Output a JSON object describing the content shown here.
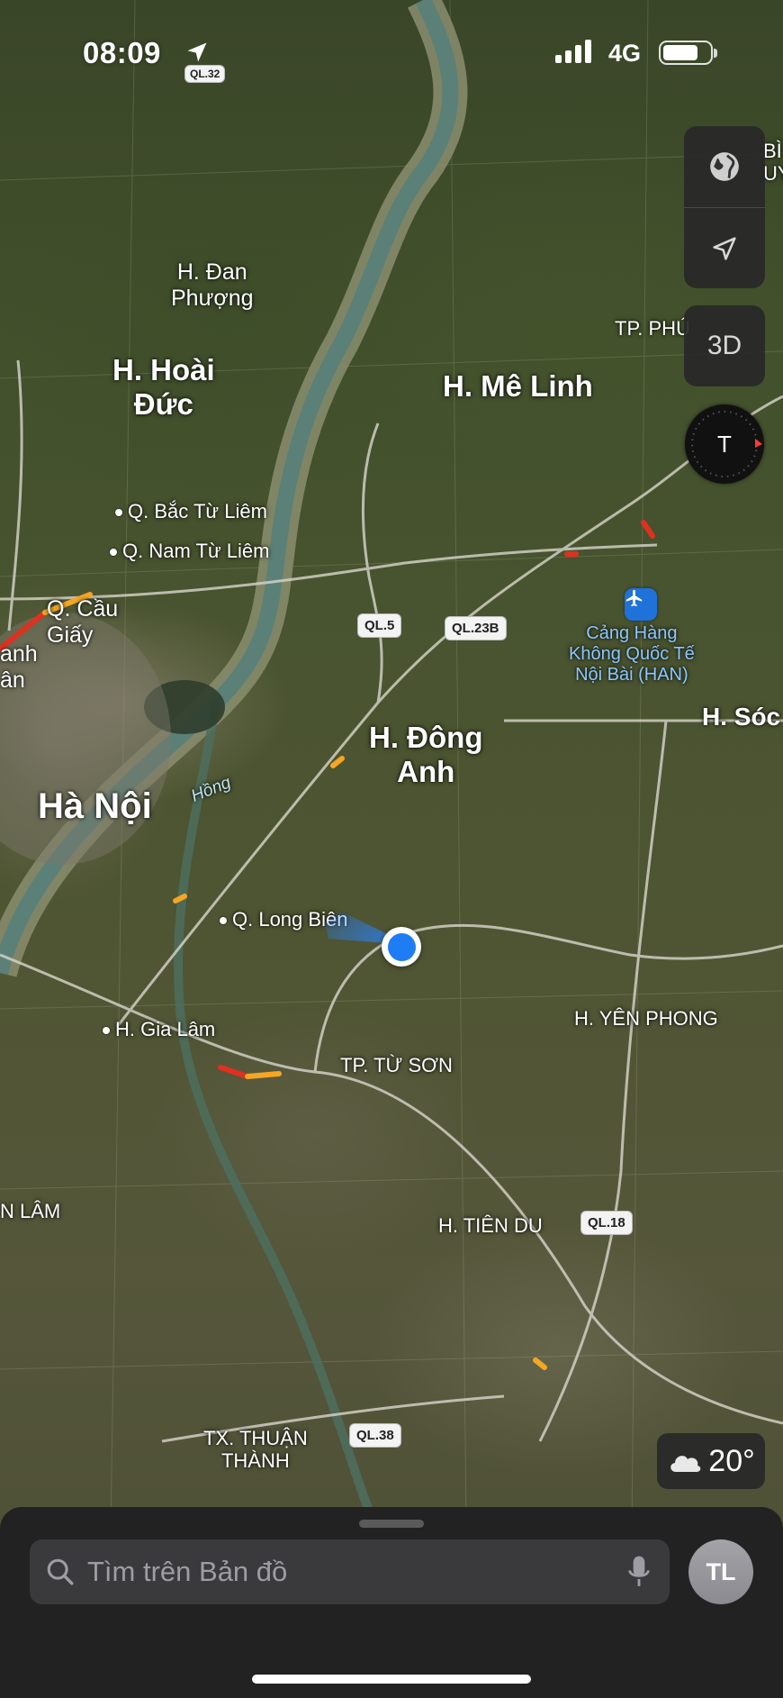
{
  "status_bar": {
    "time": "08:09",
    "network": "4G"
  },
  "map": {
    "labels": {
      "dan_phuong": "H. Đan\nPhượng",
      "hoai_duc": "H. Hoài\nĐức",
      "me_linh": "H. Mê Linh",
      "tp_phuc": "TP. PHÚ",
      "bac_tu_liem": "Q. Bắc Từ Liêm",
      "nam_tu_liem": "Q. Nam Từ Liêm",
      "cau_giay": "Q. Cầu\nGiấy",
      "thanh_xuan_partial": "anh\nân",
      "ha_noi": "Hà Nội",
      "hong_river": "Hồng",
      "dong_anh": "H. Đông\nAnh",
      "soc_son": "H. Sóc",
      "airport": "Cảng Hàng\nKhông Quốc Tế\nNội Bài (HAN)",
      "long_bien": "Q. Long Biên",
      "gia_lam": "H. Gia Lâm",
      "yen_phong": "H. YÊN PHONG",
      "tu_son": "TP. TỪ SƠN",
      "tien_du": "H. TIÊN DU",
      "thuan_thanh": "TX. THUẬN\nTHÀNH",
      "lam_partial": "N LÂM",
      "top_right_partial": "BÌ\nUY"
    },
    "shields": {
      "ql5": "QL.5",
      "ql23b": "QL.23B",
      "ql18": "QL.18",
      "ql38": "QL.38",
      "ql32": "QL.32"
    }
  },
  "controls": {
    "map_mode_icon": "globe-icon",
    "locate_icon": "location-arrow-icon",
    "view_3d_label": "3D",
    "compass_letter": "T"
  },
  "weather": {
    "icon": "cloud-icon",
    "temperature": "20°"
  },
  "search": {
    "placeholder": "Tìm trên Bản đồ"
  },
  "profile": {
    "initials": "TL"
  },
  "colors": {
    "user_location": "#1e7cf4",
    "airport_badge": "#1f72d9",
    "traffic_heavy": "#e03020",
    "traffic_moderate": "#f5a623",
    "compass_north": "#ff3b30"
  }
}
